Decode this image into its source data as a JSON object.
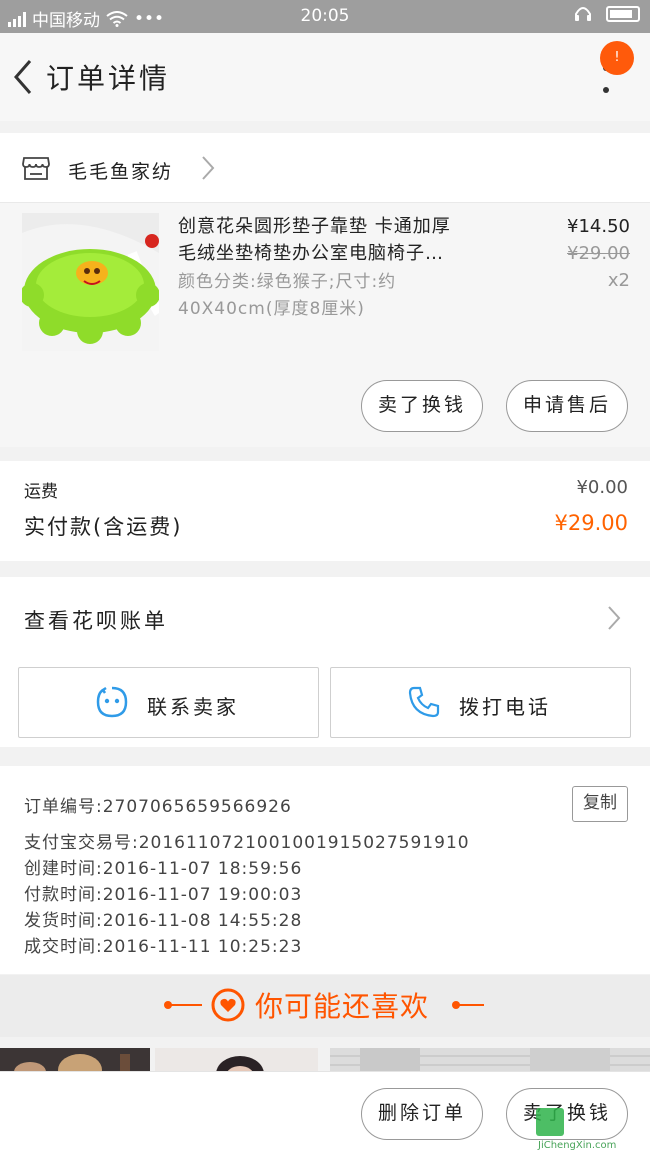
{
  "status_bar": {
    "carrier": "中国移动",
    "time": "20:05"
  },
  "header": {
    "title": "订单详情",
    "badge_count": "!"
  },
  "shop": {
    "name": "毛毛鱼家纺"
  },
  "product": {
    "title_line1": "创意花朵圆形垫子靠垫 卡通加厚",
    "title_line2": "毛绒坐垫椅垫办公室电脑椅子…",
    "attr_line1": "颜色分类:绿色猴子;尺寸:约",
    "attr_line2": "40X40cm(厚度8厘米)",
    "price": "¥14.50",
    "original_price": "¥29.00",
    "quantity": "x2",
    "btn_exchange": "卖了换钱",
    "btn_after_sale": "申请售后"
  },
  "fees": {
    "shipping_label": "运费",
    "shipping_value": "¥0.00",
    "paid_label": "实付款(含运费)",
    "paid_value": "¥29.00"
  },
  "huabei": {
    "label": "查看花呗账单",
    "contact_seller": "联系卖家",
    "call_phone": "拨打电话"
  },
  "order_info": {
    "copy_label": "复制",
    "rows": [
      "订单编号:2707065659566926",
      "支付宝交易号:2016110721001001915027591910",
      "创建时间:2016-11-07 18:59:56",
      "付款时间:2016-11-07 19:00:03",
      "发货时间:2016-11-08 14:55:28",
      "成交时间:2016-11-11 10:25:23"
    ]
  },
  "recommend": {
    "title": "你可能还喜欢"
  },
  "bottom_bar": {
    "delete_order": "删除订单",
    "sell_exchange": "卖了换钱"
  },
  "watermark": {
    "url": "JiChengXin.com"
  },
  "colors": {
    "accent": "#ff5a0b",
    "price_orange": "#ff6200",
    "icon_blue": "#2f9be8"
  }
}
